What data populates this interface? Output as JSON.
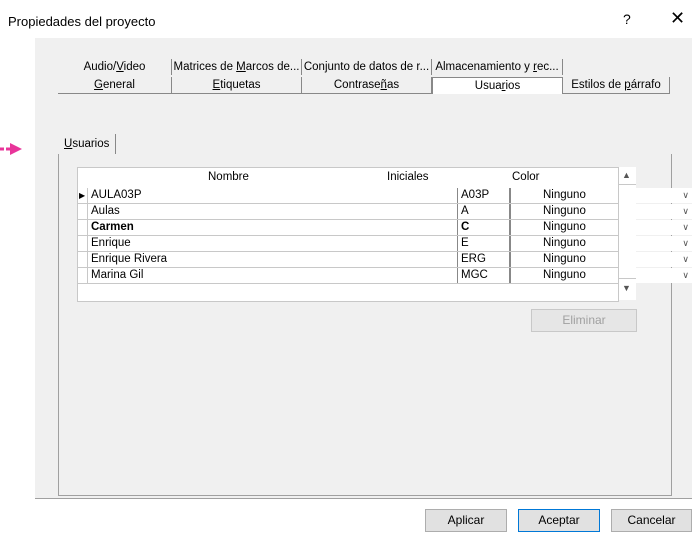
{
  "window": {
    "title": "Propiedades del proyecto",
    "help": "?",
    "close": "✕"
  },
  "tabs_row1": [
    {
      "label_pre": "Audio/",
      "label_u": "V",
      "label_post": "ideo"
    },
    {
      "label_pre": "Matrices de ",
      "label_u": "M",
      "label_post": "arcos de..."
    },
    {
      "label_pre": "Conjunto de datos de r...",
      "label_u": "",
      "label_post": ""
    },
    {
      "label_pre": "Almacenamiento y ",
      "label_u": "r",
      "label_post": "ec..."
    }
  ],
  "tabs_row2": [
    {
      "label_pre": "",
      "label_u": "G",
      "label_post": "eneral"
    },
    {
      "label_pre": "",
      "label_u": "E",
      "label_post": "tiquetas"
    },
    {
      "label_pre": "Contrase",
      "label_u": "ñ",
      "label_post": "as"
    },
    {
      "label_pre": "Usua",
      "label_u": "r",
      "label_post": "ios"
    },
    {
      "label_pre": "Estilos de ",
      "label_u": "p",
      "label_post": "árrafo"
    }
  ],
  "subtab": {
    "label_u": "U",
    "label_post": "suarios"
  },
  "table": {
    "headers": {
      "name": "Nombre",
      "initials": "Iniciales",
      "color": "Color"
    },
    "rows": [
      {
        "name": "AULA03P",
        "initials": "A03P",
        "color": "Ninguno",
        "bold": false,
        "current": true
      },
      {
        "name": "Aulas",
        "initials": "A",
        "color": "Ninguno",
        "bold": false,
        "current": false
      },
      {
        "name": "Carmen",
        "initials": "C",
        "color": "Ninguno",
        "bold": true,
        "current": false
      },
      {
        "name": "Enrique",
        "initials": "E",
        "color": "Ninguno",
        "bold": false,
        "current": false
      },
      {
        "name": "Enrique Rivera",
        "initials": "ERG",
        "color": "Ninguno",
        "bold": false,
        "current": false
      },
      {
        "name": "Marina Gil",
        "initials": "MGC",
        "color": "Ninguno",
        "bold": false,
        "current": false
      }
    ]
  },
  "buttons": {
    "delete": "Eliminar",
    "apply": "Aplicar",
    "accept": "Aceptar",
    "cancel": "Cancelar"
  },
  "colors": {
    "arrow": "#e8359a",
    "accent": "#0078d7"
  }
}
